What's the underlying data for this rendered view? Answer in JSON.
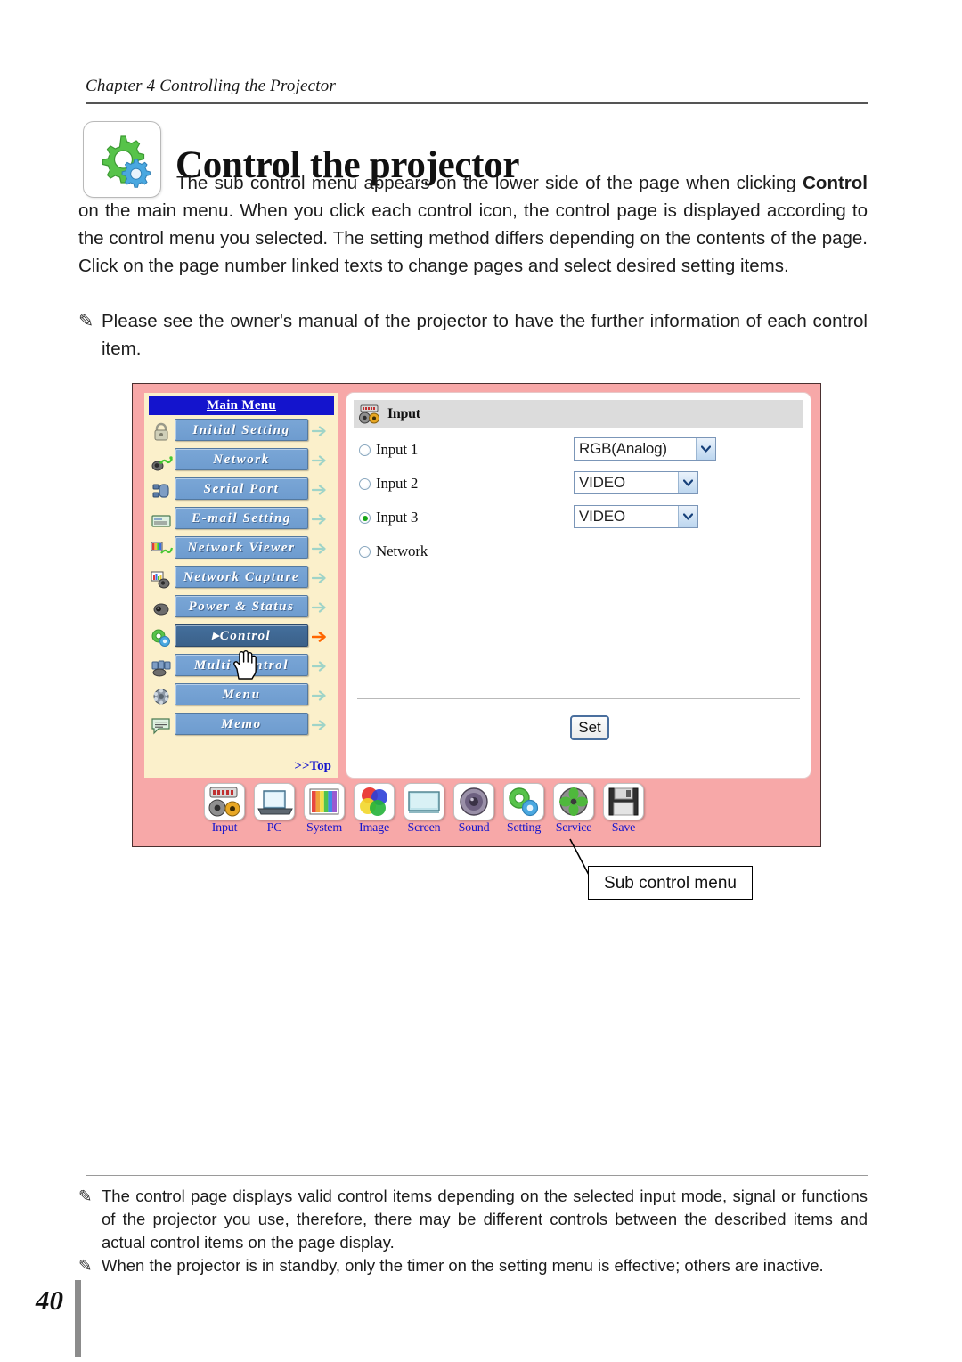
{
  "header": {
    "chapter": "Chapter 4 Controlling the Projector"
  },
  "title": {
    "text": "Control the projector",
    "icon": "gears-icon"
  },
  "intro": {
    "line1": "The sub control menu appears on the lower side of the page when clicking",
    "control_word": "Control",
    "rest": " on the main menu. When you click each control icon, the control page is displayed according to the control menu you selected. The setting method differs depending on the contents of the page. Click on the page number linked texts to change pages and select desired setting items.",
    "note": "Please see the owner's manual of the projector to have the further information of each control item."
  },
  "figure": {
    "menu": {
      "title": "Main Menu",
      "items": [
        {
          "label": "Initial Setting",
          "icon": "lock-icon",
          "active": false
        },
        {
          "label": "Network",
          "icon": "network-icon",
          "active": false
        },
        {
          "label": "Serial Port",
          "icon": "serial-port-icon",
          "active": false
        },
        {
          "label": "E-mail Setting",
          "icon": "email-icon",
          "active": false
        },
        {
          "label": "Network Viewer",
          "icon": "network-viewer-icon",
          "active": false
        },
        {
          "label": "Network Capture",
          "icon": "network-capture-icon",
          "active": false
        },
        {
          "label": "Power & Status",
          "icon": "power-status-icon",
          "active": false
        },
        {
          "label": "Control",
          "icon": "control-gears-icon",
          "active": true
        },
        {
          "label": "Multi Control",
          "icon": "multi-control-icon",
          "active": false
        },
        {
          "label": "Menu",
          "icon": "menu-icon",
          "active": false
        },
        {
          "label": "Memo",
          "icon": "memo-icon",
          "active": false
        }
      ],
      "top_link": ">>Top"
    },
    "panel": {
      "header_title": "Input",
      "header_icon": "input-connector-icon",
      "rows": [
        {
          "label": "Input 1",
          "selected": false,
          "value": "RGB(Analog)",
          "has_select": true
        },
        {
          "label": "Input 2",
          "selected": false,
          "value": "VIDEO",
          "has_select": true
        },
        {
          "label": "Input 3",
          "selected": true,
          "value": "VIDEO",
          "has_select": true
        },
        {
          "label": "Network",
          "selected": false,
          "value": "",
          "has_select": false
        }
      ],
      "set_button": "Set"
    },
    "subbar": [
      {
        "label": "Input",
        "icon": "input-connector-icon"
      },
      {
        "label": "PC",
        "icon": "laptop-icon"
      },
      {
        "label": "System",
        "icon": "color-bars-icon"
      },
      {
        "label": "Image",
        "icon": "color-circles-icon"
      },
      {
        "label": "Screen",
        "icon": "screen-icon"
      },
      {
        "label": "Sound",
        "icon": "speaker-icon"
      },
      {
        "label": "Setting",
        "icon": "gears-icon"
      },
      {
        "label": "Service",
        "icon": "fan-icon"
      },
      {
        "label": "Save",
        "icon": "floppy-disk-icon"
      }
    ],
    "callout": "Sub control menu"
  },
  "footer": {
    "notes": [
      "The control page displays valid control items depending on the selected input mode, signal or functions of the projector you use, therefore, there may be different controls between the described items and actual control items on the page display.",
      "When the projector is in standby, only the timer on the setting menu is effective; others are inactive."
    ],
    "page_number": "40"
  },
  "colors": {
    "figure_border_pink": "#f7a8a8",
    "menu_cream": "#fbf0cb",
    "menu_title_blue": "#1414cd",
    "menu_button_blue": "#7aa6d6",
    "menu_active_blue": "#446f9d",
    "active_arrow_orange": "#ff6600",
    "link_blue": "#1414cd"
  }
}
